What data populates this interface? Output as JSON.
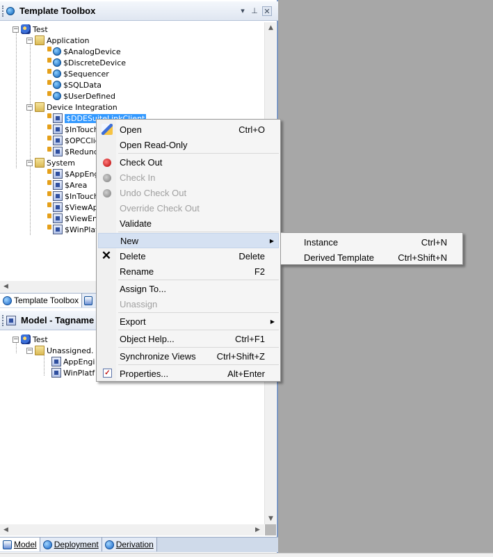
{
  "template_toolbox": {
    "title": "Template Toolbox",
    "tree": {
      "root": "Test",
      "groups": [
        {
          "label": "Application",
          "items": [
            "$AnalogDevice",
            "$DiscreteDevice",
            "$Sequencer",
            "$SQLData",
            "$UserDefined"
          ]
        },
        {
          "label": "Device Integration",
          "items": [
            "$DDESuiteLinkClient",
            "$InTouch",
            "$OPCClie",
            "$Redund"
          ]
        },
        {
          "label": "System",
          "items": [
            "$AppEng",
            "$Area",
            "$InTouch",
            "$ViewAp",
            "$ViewEn",
            "$WinPlat"
          ]
        }
      ]
    },
    "tab_label": "Template Toolbox"
  },
  "model_panel": {
    "title": "Model - Tagname",
    "tree": {
      "root": "Test",
      "group": "Unassigned.",
      "items": [
        "AppEngi",
        "WinPlatf"
      ]
    }
  },
  "bottom_tabs": [
    {
      "label": "Model"
    },
    {
      "label": "Deployment"
    },
    {
      "label": "Derivation"
    }
  ],
  "context_menu": {
    "items": [
      {
        "label": "Open",
        "shortcut": "Ctrl+O"
      },
      {
        "label": "Open Read-Only",
        "shortcut": ""
      },
      {
        "label": "Check Out",
        "shortcut": ""
      },
      {
        "label": "Check In",
        "shortcut": ""
      },
      {
        "label": "Undo Check Out",
        "shortcut": ""
      },
      {
        "label": "Override Check Out",
        "shortcut": ""
      },
      {
        "label": "Validate",
        "shortcut": ""
      },
      {
        "label": "New",
        "shortcut": ""
      },
      {
        "label": "Delete",
        "shortcut": "Delete"
      },
      {
        "label": "Rename",
        "shortcut": "F2"
      },
      {
        "label": "Assign To...",
        "shortcut": ""
      },
      {
        "label": "Unassign",
        "shortcut": ""
      },
      {
        "label": "Export",
        "shortcut": ""
      },
      {
        "label": "Object Help...",
        "shortcut": "Ctrl+F1"
      },
      {
        "label": "Synchronize Views",
        "shortcut": "Ctrl+Shift+Z"
      },
      {
        "label": "Properties...",
        "shortcut": "Alt+Enter"
      }
    ]
  },
  "submenu_new": {
    "items": [
      {
        "label": "Instance",
        "shortcut": "Ctrl+N"
      },
      {
        "label": "Derived Template",
        "shortcut": "Ctrl+Shift+N"
      }
    ]
  }
}
